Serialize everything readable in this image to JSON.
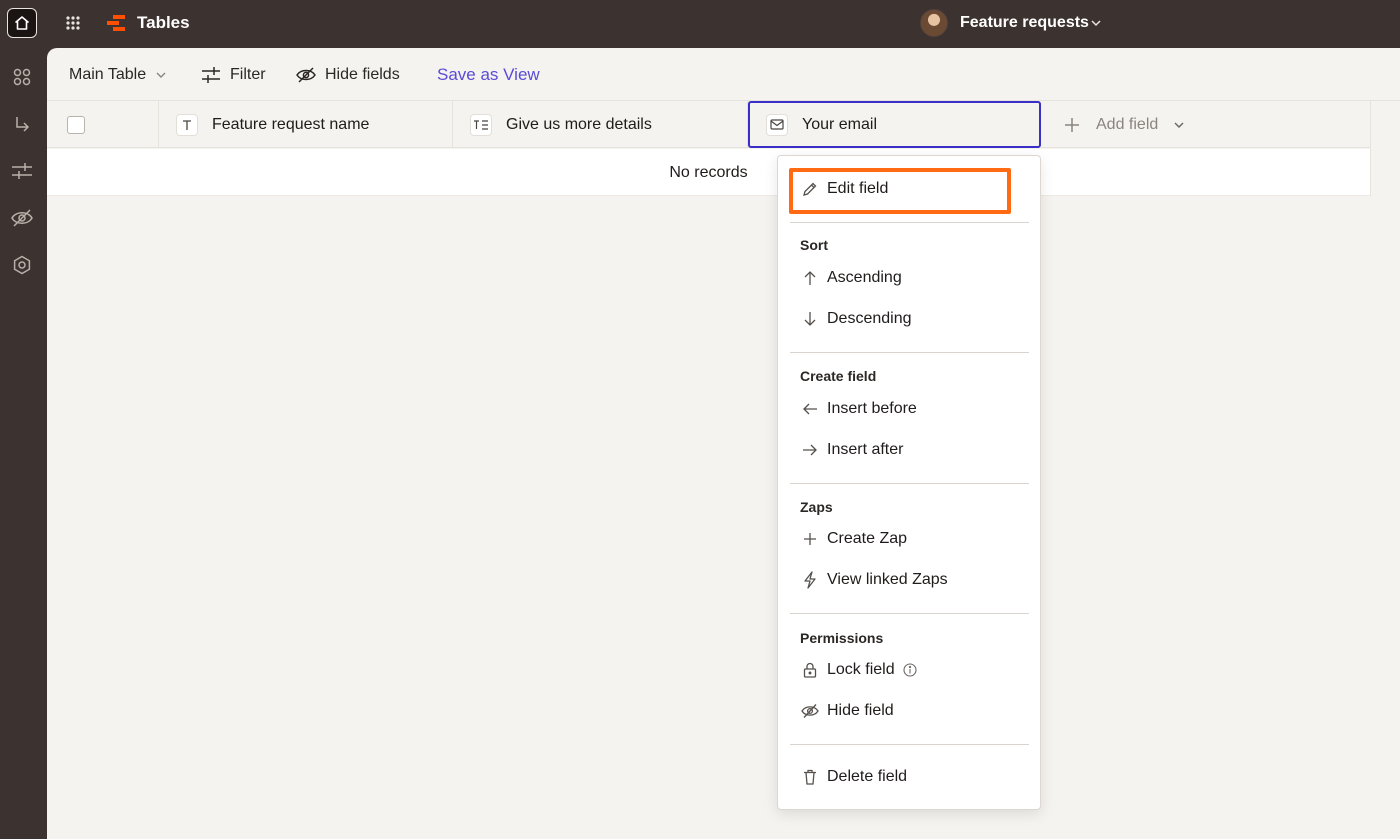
{
  "app": {
    "title": "Tables",
    "brand_color": "#ff4f00"
  },
  "header": {
    "current_table": "Feature requests"
  },
  "toolbar": {
    "view_name": "Main Table",
    "filter_label": "Filter",
    "hide_fields_label": "Hide fields",
    "save_view_label": "Save as View"
  },
  "table": {
    "columns": [
      {
        "name": "Feature request name",
        "icon": "text-icon"
      },
      {
        "name": "Give us more details",
        "icon": "long-text-icon"
      },
      {
        "name": "Your email",
        "icon": "email-icon"
      }
    ],
    "add_field_label": "Add field",
    "empty_message": "No records"
  },
  "context_menu": {
    "edit_field": "Edit field",
    "sort": {
      "heading": "Sort",
      "ascending": "Ascending",
      "descending": "Descending"
    },
    "create_field": {
      "heading": "Create field",
      "insert_before": "Insert before",
      "insert_after": "Insert after"
    },
    "zaps": {
      "heading": "Zaps",
      "create_zap": "Create Zap",
      "view_linked": "View linked Zaps"
    },
    "permissions": {
      "heading": "Permissions",
      "lock_field": "Lock field",
      "hide_field": "Hide field"
    },
    "delete_field": "Delete field",
    "highlight_color": "#ff6a13"
  },
  "colors": {
    "accent": "#5a4bd6",
    "selected_border": "#3a2fc7",
    "topbar": "#3c3230"
  }
}
